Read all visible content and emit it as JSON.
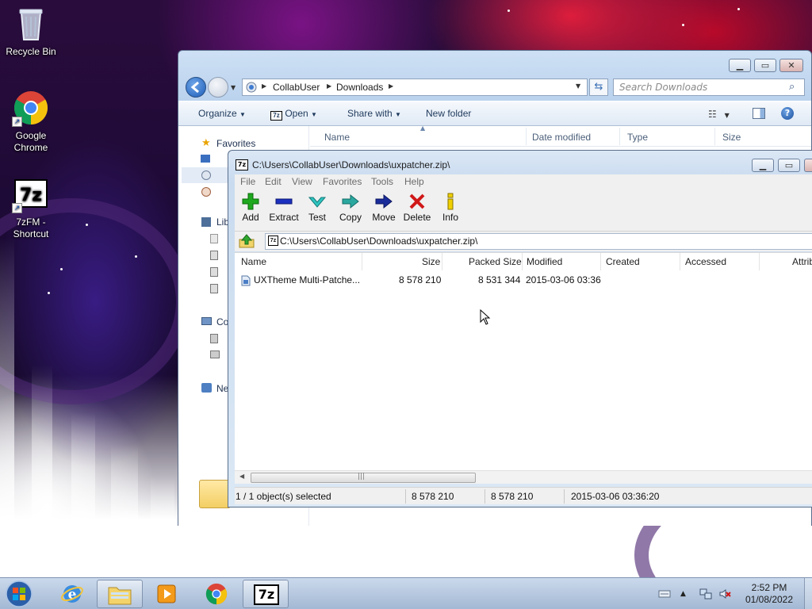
{
  "desktop": {
    "icons": [
      {
        "label": "Recycle Bin"
      },
      {
        "label": "Google Chrome"
      },
      {
        "label": "7zFM - Shortcut"
      }
    ]
  },
  "explorer": {
    "breadcrumb": [
      "CollabUser",
      "Downloads"
    ],
    "search_placeholder": "Search Downloads",
    "toolbar": {
      "organize": "Organize",
      "open": "Open",
      "share_with": "Share with",
      "new_folder": "New folder"
    },
    "nav": {
      "favorites": "Favorites",
      "libraries_partial": "Lib",
      "computer_partial": "Co",
      "network_partial": "Ne"
    },
    "columns": [
      "Name",
      "Date modified",
      "Type",
      "Size"
    ]
  },
  "sevenzip": {
    "title": "C:\\Users\\CollabUser\\Downloads\\uxpatcher.zip\\",
    "menu": [
      "File",
      "Edit",
      "View",
      "Favorites",
      "Tools",
      "Help"
    ],
    "tools": [
      "Add",
      "Extract",
      "Test",
      "Copy",
      "Move",
      "Delete",
      "Info"
    ],
    "path": "C:\\Users\\CollabUser\\Downloads\\uxpatcher.zip\\",
    "columns": [
      "Name",
      "Size",
      "Packed Size",
      "Modified",
      "Created",
      "Accessed",
      "Attrib"
    ],
    "rows": [
      {
        "name": "UXTheme Multi-Patche...",
        "size": "8 578 210",
        "packed": "8 531 344",
        "modified": "2015-03-06 03:36"
      }
    ],
    "status": {
      "selected": "1 / 1 object(s) selected",
      "size": "8 578 210",
      "packed": "8 578 210",
      "modified": "2015-03-06 03:36:20"
    }
  },
  "taskbar": {
    "apps": [
      "Start",
      "Internet Explorer",
      "Windows Explorer",
      "Windows Media Player",
      "Google Chrome",
      "7-Zip File Manager"
    ],
    "clock": {
      "time": "2:52 PM",
      "date": "01/08/2022"
    }
  }
}
